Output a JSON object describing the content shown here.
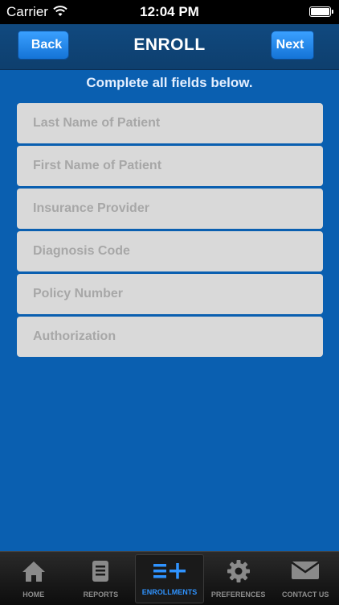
{
  "status_bar": {
    "carrier": "Carrier",
    "time": "12:04 PM"
  },
  "nav": {
    "title": "ENROLL",
    "back_label": "Back",
    "next_label": "Next"
  },
  "instructions": "Complete all fields below.",
  "fields": [
    {
      "placeholder": "Last Name of Patient"
    },
    {
      "placeholder": "First Name of Patient"
    },
    {
      "placeholder": "Insurance Provider"
    },
    {
      "placeholder": "Diagnosis Code"
    },
    {
      "placeholder": "Policy Number"
    },
    {
      "placeholder": "Authorization"
    }
  ],
  "tabs": [
    {
      "label": "HOME",
      "icon": "house-icon"
    },
    {
      "label": "REPORTS",
      "icon": "document-icon"
    },
    {
      "label": "ENROLLMENTS",
      "icon": "list-add-icon",
      "active": true
    },
    {
      "label": "PREFERENCES",
      "icon": "gear-icon"
    },
    {
      "label": "CONTACT US",
      "icon": "envelope-icon"
    }
  ],
  "colors": {
    "background": "#0a5fb0",
    "navbar": "#0e3f6e",
    "button": "#1b7fe6",
    "tab_active": "#2f93ff"
  }
}
